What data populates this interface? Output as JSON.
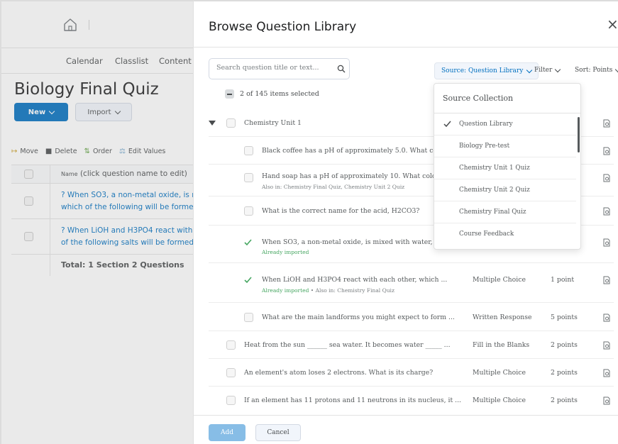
{
  "background": {
    "nav": [
      "Calendar",
      "Classlist",
      "Content"
    ],
    "page_title": "Biology Final Quiz",
    "new_label": "New",
    "import_label": "Import",
    "toolbar": [
      "Move",
      "Delete",
      "Order",
      "Edit Values"
    ],
    "table": {
      "header_prefix": "Name",
      "header_text": "(click question name to edit)",
      "rows": [
        {
          "line1": "? When SO3, a non-metal oxide, is m",
          "line2": "which of the following will be formed"
        },
        {
          "line1": "? When LiOH and H3PO4 react with",
          "line2": "of the following salts will be formed?"
        }
      ],
      "total": "Total:  1 Section   2 Questions"
    }
  },
  "dialog": {
    "title": "Browse Question Library",
    "close": "×",
    "search_placeholder": "Search question title or text...",
    "source_label": "Source:  Question Library",
    "filter_label": "Filter",
    "sort_label": "Sort: Points",
    "selected_text": "2 of 145 items selected",
    "section_name": "Chemistry Unit 1",
    "rows": [
      {
        "text": "Black coffee has a pH of approximately 5.0. What color",
        "sub": "",
        "type": "",
        "points": ""
      },
      {
        "text": "Hand soap has a pH of approximately 10. What color wil",
        "sub": "Also in: Chemistry Final Quiz, Chemistry Unit 2 Quiz",
        "type": "",
        "points": ""
      },
      {
        "text": "What is the correct name for the acid, H2CO3?",
        "sub": "",
        "type": "",
        "points": ""
      },
      {
        "text": "When SO3, a non-metal oxide, is mixed with water, whi...",
        "sub": "Already imported",
        "type": "",
        "points": ""
      },
      {
        "text": "When LiOH and H3PO4 react with each other, which ...",
        "sub": "Already imported  •  Also in: Chemistry Final Quiz",
        "type": "Multiple Choice",
        "points": "1 point"
      },
      {
        "text": "What are the main landforms you might expect to form ...",
        "sub": "",
        "type": "Written Response",
        "points": "5 points"
      },
      {
        "text": "Heat from the sun ______ sea water. It becomes water _____ ...",
        "sub": "",
        "type": "Fill in the Blanks",
        "points": "2 points"
      },
      {
        "text": "An element's atom loses 2 electrons. What is its charge?",
        "sub": "",
        "type": "Multiple Choice",
        "points": "2 points"
      },
      {
        "text": "If an element has 11 protons and 11 neutrons in its nucleus, it ...",
        "sub": "",
        "type": "Multiple Choice",
        "points": "2 points"
      }
    ],
    "add_label": "Add",
    "cancel_label": "Cancel"
  },
  "dropdown": {
    "header": "Source Collection",
    "items": [
      "Question Library",
      "Biology Pre-test",
      "Chemistry Unit 1 Quiz",
      "Chemistry Unit 2 Quiz",
      "Chemistry Final Quiz",
      "Course Feedback"
    ],
    "selected": "Question Library"
  },
  "colors": {
    "primary": "#006fbf",
    "add_disabled": "#87bde6",
    "imported_green": "#46a661"
  },
  "icons": [
    "home-icon",
    "search-icon",
    "chevron-down-icon",
    "close-icon",
    "check-icon",
    "preview-icon",
    "caret-down-icon"
  ]
}
